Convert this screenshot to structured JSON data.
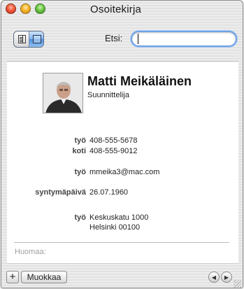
{
  "window": {
    "title": "Osoitekirja"
  },
  "toolbar": {
    "search_label": "Etsi:",
    "search_value": "",
    "view_mode": "card"
  },
  "card": {
    "name": "Matti Meikäläinen",
    "job_title": "Suunnittelija",
    "fields": [
      {
        "label": "työ",
        "value": "408-555-5678"
      },
      {
        "label": "koti",
        "value": "408-555-9012"
      },
      {
        "label": "työ",
        "value": "mmeika3@mac.com"
      },
      {
        "label": "syntymäpäivä",
        "value": "26.07.1960"
      },
      {
        "label": "työ",
        "value": "Keskuskatu 1000"
      }
    ],
    "address_line2": "Helsinki 00100",
    "note_label": "Huomaa:"
  },
  "bottombar": {
    "add_label": "+",
    "edit_label": "Muokkaa",
    "prev_label": "◀",
    "next_label": "▶"
  },
  "colors": {
    "search_focus": "#6ea2e6",
    "selected_segment": "#4f8fdc"
  }
}
